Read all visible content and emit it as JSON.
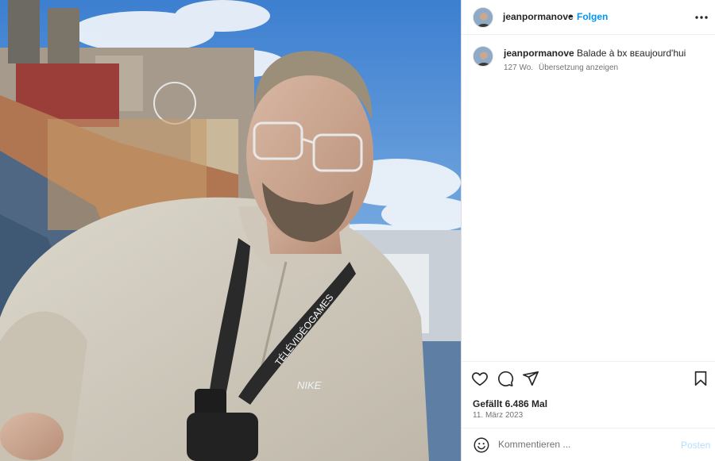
{
  "post": {
    "username": "jeanpormanove",
    "follow_label": "Folgen",
    "separator": "•",
    "more_icon": "more-horizontal-icon",
    "caption": {
      "username": "jeanpormanove",
      "text": "Balade à bx ʙᴇaujourd'hui",
      "time_ago": "127 Wo.",
      "translate_label": "Übersetzung anzeigen"
    },
    "actions": {
      "like_icon": "heart-icon",
      "comment_icon": "comment-icon",
      "share_icon": "send-icon",
      "save_icon": "bookmark-icon"
    },
    "likes_text": "Gefällt 6.486 Mal",
    "date": "11. März 2023",
    "comment_box": {
      "placeholder": "Kommentieren ...",
      "post_label": "Posten",
      "emoji_icon": "emoji-icon"
    }
  },
  "photo": {
    "alt": "Selfie on a rooftop with city view",
    "lanyard_text": "TÉLÉVIDÉOGAMES",
    "sweater_logo": "NIKE"
  },
  "colors": {
    "accent": "#0095f6",
    "post_disabled": "#b2dffc",
    "text": "#262626",
    "muted": "#737373"
  }
}
